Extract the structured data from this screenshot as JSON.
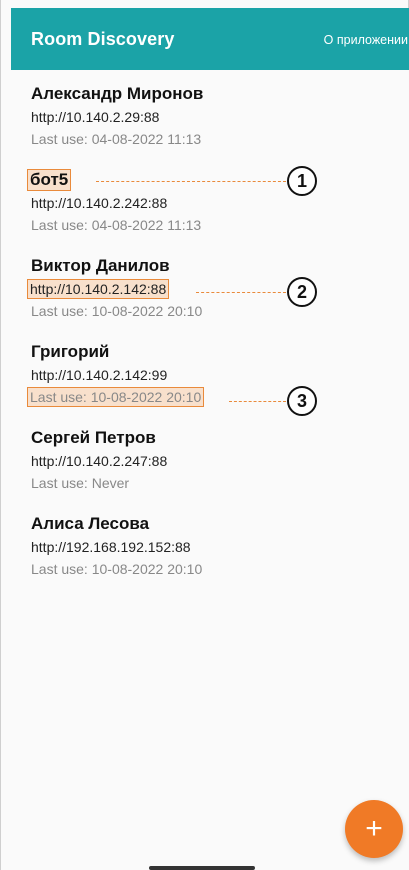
{
  "appbar": {
    "title": "Room Discovery",
    "action_label": "О приложении",
    "color": "#1ba3a7"
  },
  "rooms": [
    {
      "name": "Александр Миронов",
      "url": "http://10.140.2.29:88",
      "last_use": "Last use: 04-08-2022 11:13"
    },
    {
      "name": "бот5",
      "url": "http://10.140.2.242:88",
      "last_use": "Last use: 04-08-2022 11:13"
    },
    {
      "name": "Виктор Данилов",
      "url": "http://10.140.2.142:88",
      "last_use": "Last use: 10-08-2022 20:10"
    },
    {
      "name": "Григорий",
      "url": "http://10.140.2.142:99",
      "last_use": "Last use: 10-08-2022 20:10"
    },
    {
      "name": "Сергей Петров",
      "url": "http://10.140.2.247:88",
      "last_use": "Last use: Never"
    },
    {
      "name": "Алиса Лесова",
      "url": "http://192.168.192.152:88",
      "last_use": "Last use: 10-08-2022 20:10"
    }
  ],
  "callouts": [
    "1",
    "2",
    "3"
  ],
  "fab": {
    "icon": "plus-icon",
    "glyph": "+",
    "color": "#f07a26"
  },
  "highlight_color": "#e98a3b"
}
